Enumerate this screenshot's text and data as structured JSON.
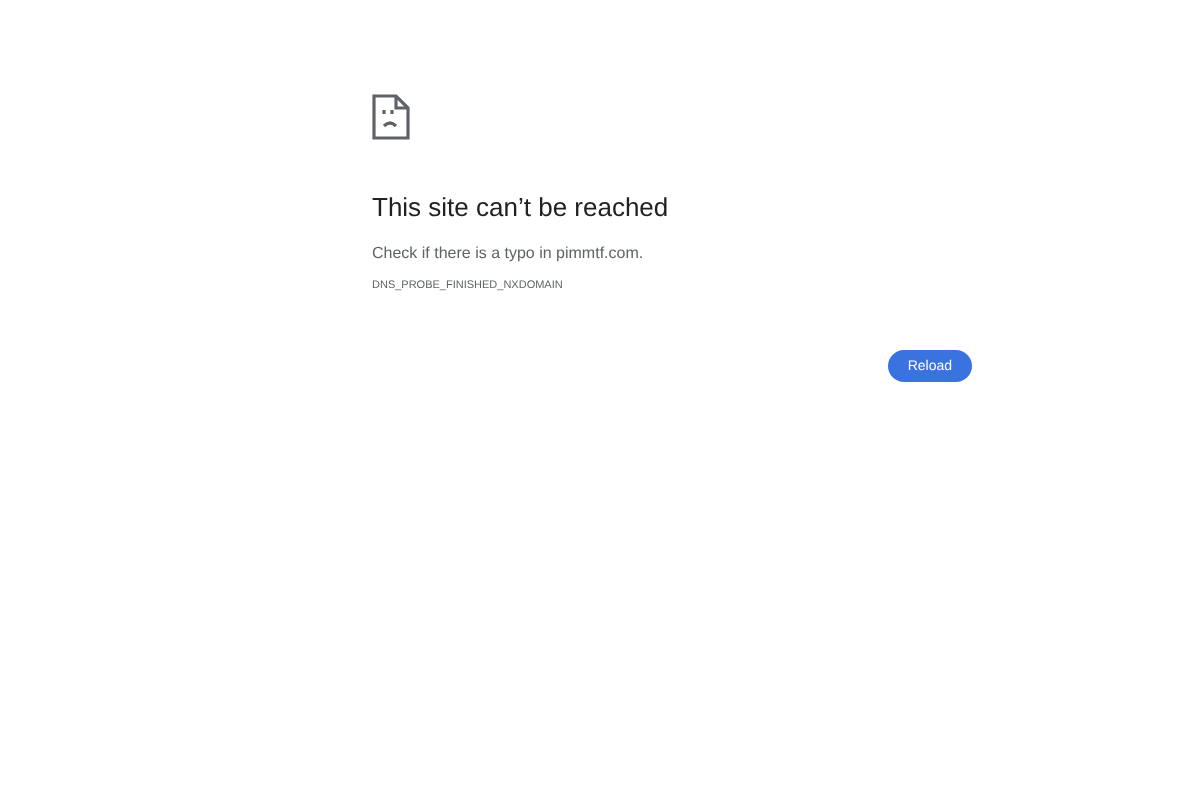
{
  "heading": "This site can’t be reached",
  "message": "Check if there is a typo in pimmtf.com.",
  "error_code": "DNS_PROBE_FINISHED_NXDOMAIN",
  "buttons": [
    "Reload"
  ]
}
